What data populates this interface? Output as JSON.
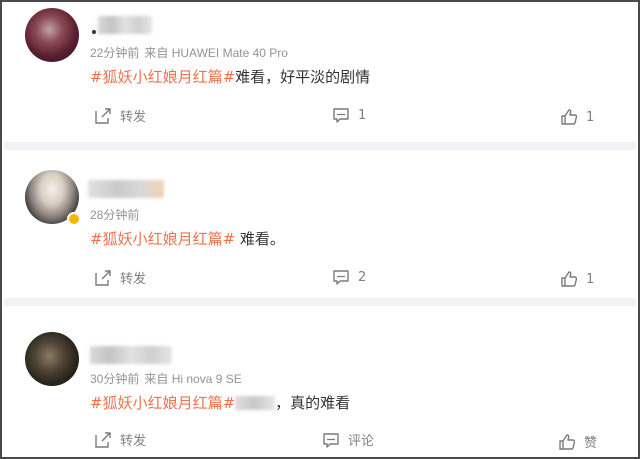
{
  "comments": [
    {
      "time": "22分钟前",
      "source": "来自 HUAWEI Mate 40 Pro",
      "tag": "#狐妖小红娘月红篇#",
      "text": "难看，好平淡的剧情",
      "actions": {
        "repost": "转发",
        "comment": "1",
        "like": "1"
      }
    },
    {
      "time": "28分钟前",
      "source": "",
      "tag": "#狐妖小红娘月红篇#",
      "text": " 难看。",
      "actions": {
        "repost": "转发",
        "comment": "2",
        "like": "1"
      }
    },
    {
      "time": "30分钟前",
      "source": "来自 Hi nova 9 SE",
      "tag": "#狐妖小红娘月红篇#",
      "text": "，真的难看",
      "actions": {
        "repost": "转发",
        "comment": "评论",
        "like": "赞"
      }
    }
  ],
  "icons": {
    "repost": "share-arrow-icon",
    "comment": "comment-bubble-icon",
    "like": "thumbs-up-icon",
    "verified": "verified-badge-icon"
  },
  "colors": {
    "tag": "#eb7350",
    "meta": "#939393",
    "action": "#808080",
    "separator": "#f1f2f5",
    "verified": "#f5b700"
  }
}
